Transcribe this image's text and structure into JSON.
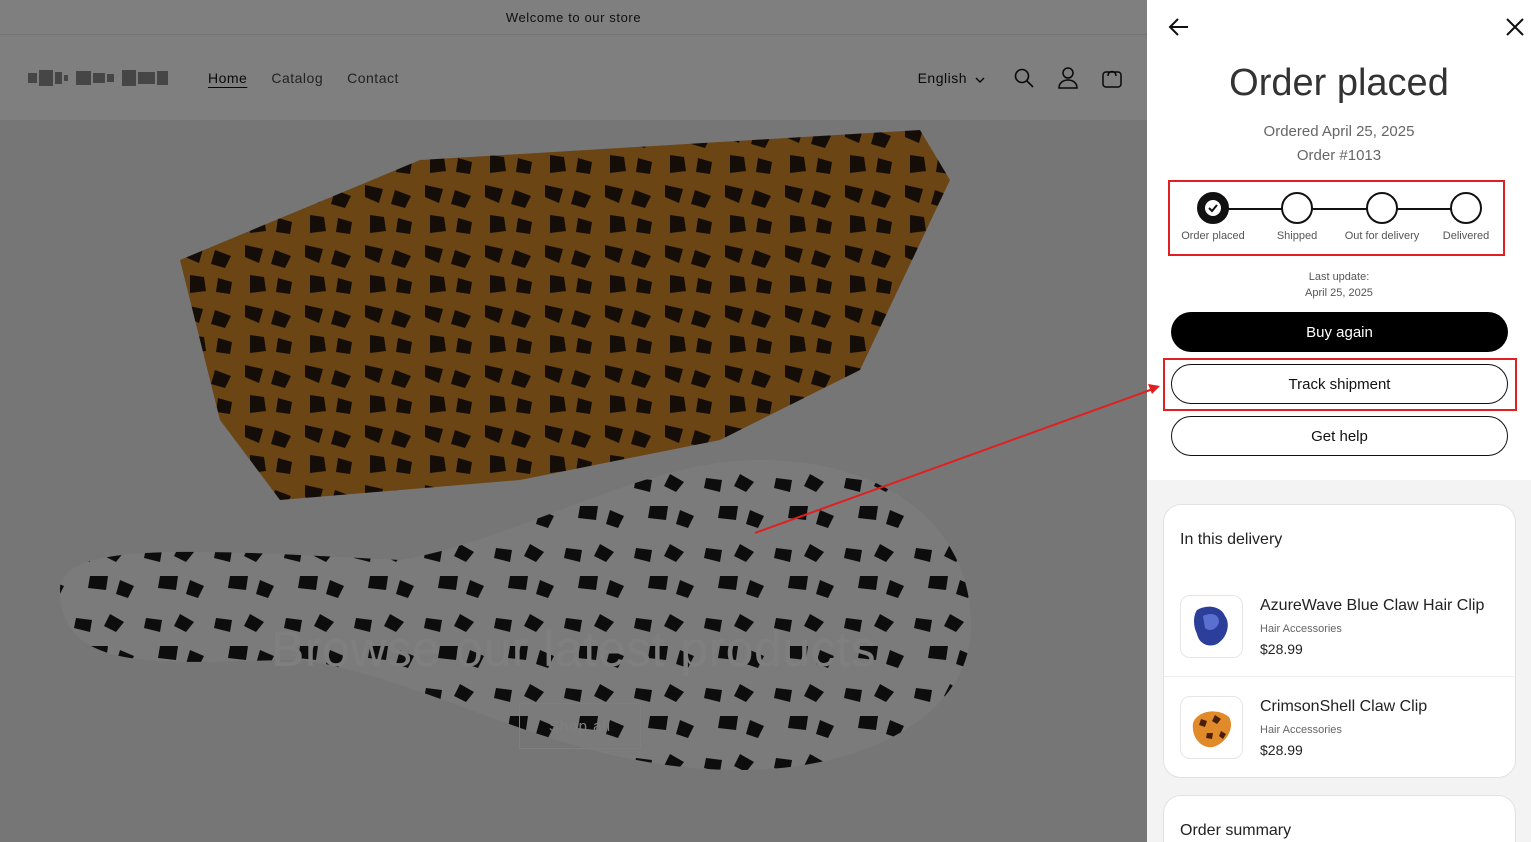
{
  "store": {
    "announcement": "Welcome to our store",
    "nav": [
      {
        "label": "Home",
        "active": true
      },
      {
        "label": "Catalog",
        "active": false
      },
      {
        "label": "Contact",
        "active": false
      }
    ],
    "language": "English",
    "hero": {
      "title": "Browse our latest products",
      "button_label": "Shop all"
    }
  },
  "drawer": {
    "title": "Order placed",
    "ordered_date": "Ordered April 25, 2025",
    "order_number": "Order #1013",
    "steps": [
      {
        "label": "Order placed",
        "done": true
      },
      {
        "label": "Shipped",
        "done": false
      },
      {
        "label": "Out for delivery",
        "done": false
      },
      {
        "label": "Delivered",
        "done": false
      }
    ],
    "last_update_label": "Last update:",
    "last_update_date": "April 25, 2025",
    "buy_again_label": "Buy again",
    "track_label": "Track shipment",
    "help_label": "Get help",
    "delivery": {
      "title": "In this delivery",
      "items": [
        {
          "name": "AzureWave Blue Claw Hair Clip",
          "category": "Hair Accessories",
          "price": "$28.99"
        },
        {
          "name": "CrimsonShell Claw Clip",
          "category": "Hair Accessories",
          "price": "$28.99"
        }
      ]
    },
    "summary_title": "Order summary"
  },
  "colors": {
    "accent": "#000000",
    "highlight": "#e02020"
  }
}
